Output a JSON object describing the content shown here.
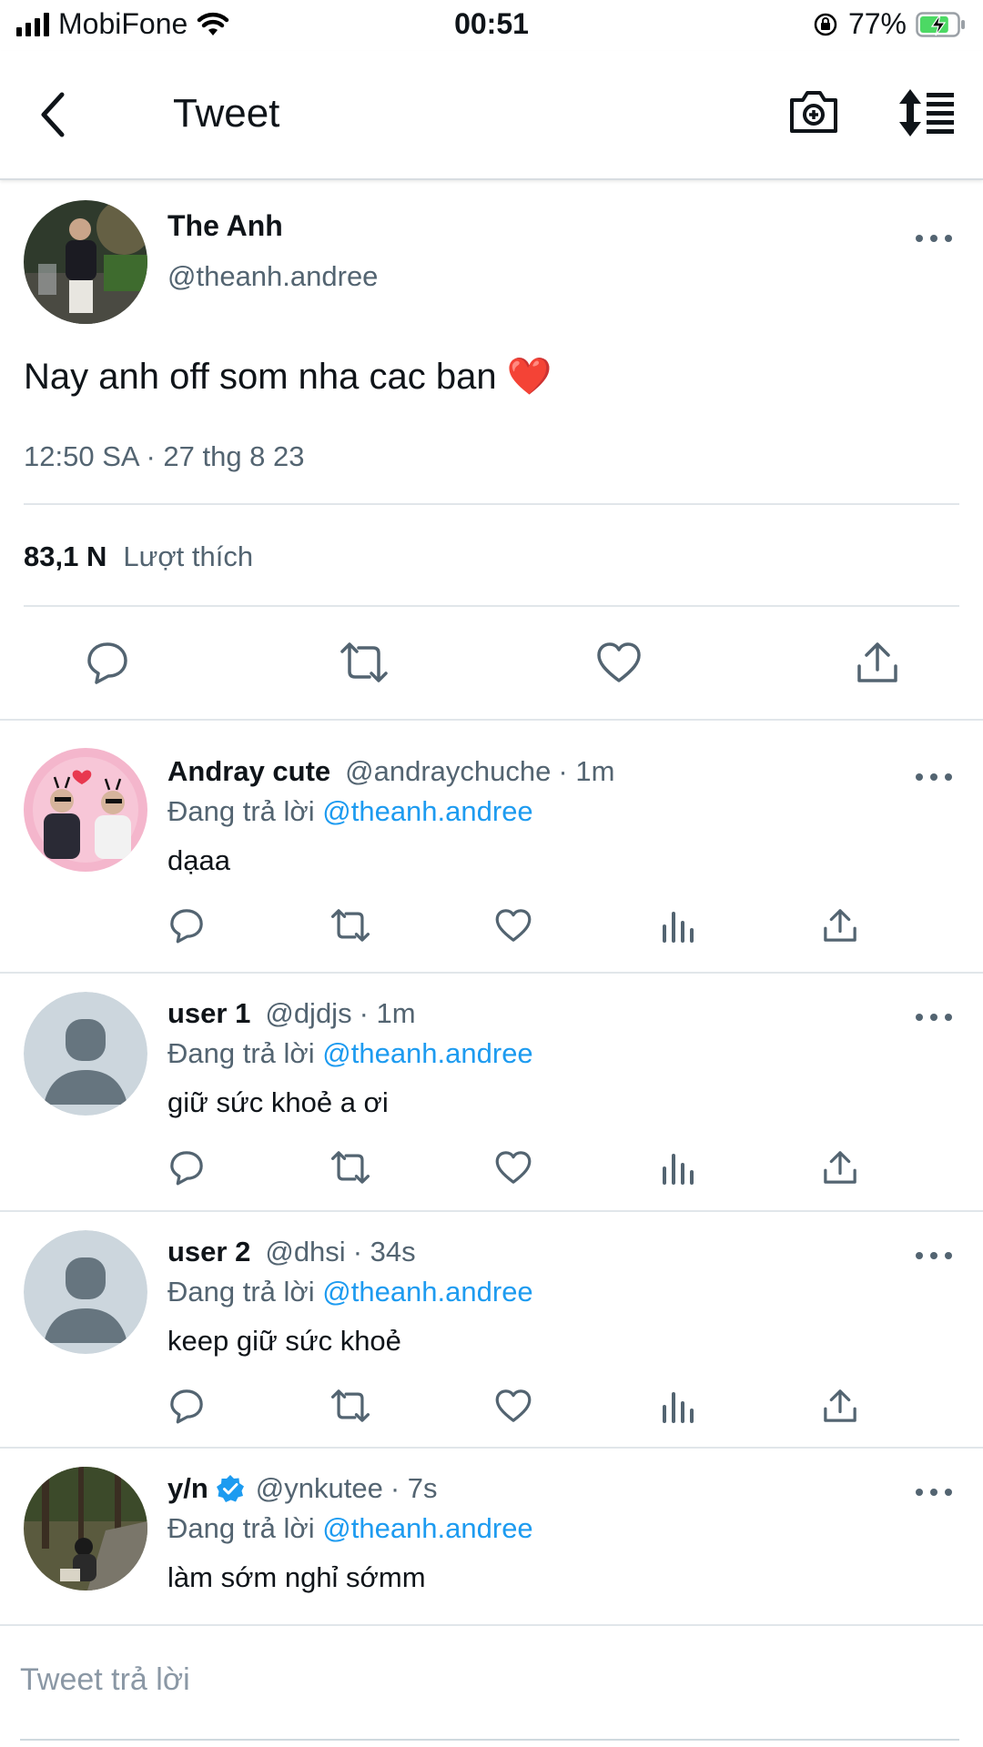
{
  "status_bar": {
    "carrier": "MobiFone",
    "time": "00:51",
    "battery": "77%",
    "battery_level": 0.77
  },
  "nav": {
    "title": "Tweet",
    "icons": [
      "back-chevron-icon",
      "camera-plus-icon",
      "sort-icon"
    ]
  },
  "main_tweet": {
    "name": "The Anh",
    "handle": "@theanh.andree",
    "text": "Nay anh off som nha cac ban",
    "emoji": "❤️",
    "timestamp": "12:50 SA · 27 thg 8 23",
    "likes_count": "83,1 N",
    "likes_label": "Lượt thích",
    "actions": [
      "reply-icon",
      "retweet-icon",
      "like-icon",
      "share-icon"
    ]
  },
  "replies": [
    {
      "name": "Andray cute",
      "handle": "@andraychuche",
      "time": "· 1m",
      "verified": false,
      "replying_label": "Đang trả lời",
      "replying_to": "@theanh.andree",
      "text": "dạaa",
      "avatar": "photo"
    },
    {
      "name": "user 1",
      "handle": "@djdjs",
      "time": "· 1m",
      "verified": false,
      "replying_label": "Đang trả lời",
      "replying_to": "@theanh.andree",
      "text": "giữ sức khoẻ a ơi",
      "avatar": "default"
    },
    {
      "name": "user 2",
      "handle": "@dhsi",
      "time": "· 34s",
      "verified": false,
      "replying_label": "Đang trả lời",
      "replying_to": "@theanh.andree",
      "text": "keep giữ sức khoẻ",
      "avatar": "default"
    },
    {
      "name": "y/n",
      "handle": "@ynkutee",
      "time": "· 7s",
      "verified": true,
      "replying_label": "Đang trả lời",
      "replying_to": "@theanh.andree",
      "text": "làm sớm nghỉ sớmm",
      "avatar": "photo"
    }
  ],
  "compose": {
    "placeholder": "Tweet trả lời"
  },
  "colors": {
    "accent": "#1d9bf0",
    "text": "#0f1419",
    "secondary": "#536471",
    "divider": "#e1e6ea"
  }
}
